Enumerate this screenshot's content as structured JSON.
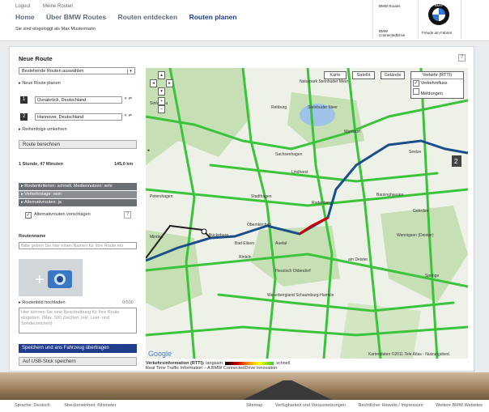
{
  "header": {
    "logout": "Logout",
    "my_routes": "Meine Routen",
    "nav": [
      "Home",
      "Über BMW Routes",
      "Routen entdecken",
      "Routen planen"
    ],
    "active_nav": "Routen planen",
    "logged_in": "Sie sind eingeloggt als Max Mustermann",
    "brand_top": "BMW Routes",
    "brand_bottom_1": "BMW",
    "brand_bottom_2": "ConnectedDrive",
    "logo_caption": "Freude am Fahren",
    "logo_text": "BMW"
  },
  "sidebar": {
    "title": "Neue Route",
    "help": "?",
    "saved_routes_select": "Bestehende Routen auswählen",
    "new_route_link": "Neue Route planen",
    "waypoints": [
      {
        "num": "1",
        "value": "Osnabrück, Deutschland"
      },
      {
        "num": "2",
        "value": "Hannover, Deutschland"
      }
    ],
    "reverse_link": "Reihenfolge umkehren",
    "calc_button": "Route berechnen",
    "duration": "1 Stunde, 47 Minuten",
    "distance": "145,0 km",
    "criteria_bar": "Routenkriterien: schnell, Mediennutzen: sehr",
    "traffic_bar": "Verkehrslage: nein",
    "alt_bar": "Alternativrouten: ja",
    "alt_checkbox_label": "Alternativrouten vorschlagen",
    "route_name_label": "Routenname",
    "route_name_placeholder": "Bitte geben Sie hier einen Namen für Ihre Route ein",
    "upload_label": "Routenbild hochladen",
    "char_count": "0/500",
    "desc_placeholder": "Hier können Sie eine Beschreibung für Ihre Route eingeben. (Max. 500 Zeichen, inkl. Leer- und Sonderzeichen)",
    "save_button": "Speichern und ans Fahrzeug übertragen",
    "usb_button": "Auf USB-Stick speichern"
  },
  "map": {
    "type_buttons": [
      "Karte",
      "Satellit",
      "Gelände"
    ],
    "traffic_title": "Verkehr (RTTI)",
    "traffic_flow": "Verkehrsfluss",
    "reports": "Meldungen",
    "copyright": "Kartendaten ©2011 Tele Atlas - Nutzungsbed.",
    "google": "Google",
    "marker_end": "2",
    "place_labels": [
      "Naturpark Steinhuder Meer",
      "Steinhuder Meer",
      "Rehburg",
      "Wunstorf",
      "Seelze",
      "Barsinghausen",
      "Gehrden",
      "Wennigsen (Deister)",
      "Springe",
      "Stadthagen",
      "Bückeburg",
      "Bad Eilsen",
      "Rinteln",
      "Lindhorst",
      "Sachsenhagen",
      "Rodenberg",
      "Auetal",
      "Obernkirchen",
      "Hessisch Oldendorf",
      "Weserbergland Schaumburg-Hameln",
      "Stolzenau",
      "Petershagen",
      "Minden",
      "am Deister"
    ]
  },
  "legend": {
    "title": "Verkehrsinformation (RTTI):",
    "slow": "langsam",
    "fast": "schnell",
    "note": "Real Time Traffic Information – A BMW ConnectedDrive Innovation"
  },
  "footer": {
    "language": "Sprache: Deutsch",
    "units": "Streckeneinheit: Kilometer",
    "links": [
      "Sitemap",
      "Verfügbarkeit und Voraussetzungen",
      "Rechtlicher Hinweis / Impressum",
      "Weitere BMW Websites"
    ]
  },
  "colors": {
    "accent": "#1f3d8a",
    "route": "#1b4f8c",
    "traffic_green": "#3cc33c",
    "nav_active": "#1f3f8c"
  }
}
